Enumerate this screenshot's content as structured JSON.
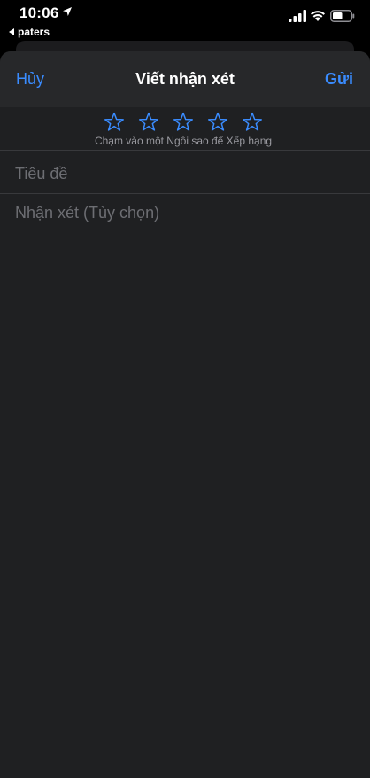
{
  "status_bar": {
    "time": "10:06",
    "back_app_label": "paters"
  },
  "nav": {
    "cancel_label": "Hủy",
    "title": "Viết nhận xét",
    "send_label": "Gửi"
  },
  "rating": {
    "stars_total": 5,
    "stars_selected": 0,
    "hint": "Chạm vào một Ngôi sao để Xếp hạng"
  },
  "form": {
    "title_placeholder": "Tiêu đề",
    "title_value": "",
    "review_placeholder": "Nhận xét (Tùy chọn)",
    "review_value": ""
  },
  "colors": {
    "accent": "#3a8cff",
    "sheet_background": "#1f2022",
    "nav_background": "#27282a",
    "placeholder": "#6d6e73"
  }
}
